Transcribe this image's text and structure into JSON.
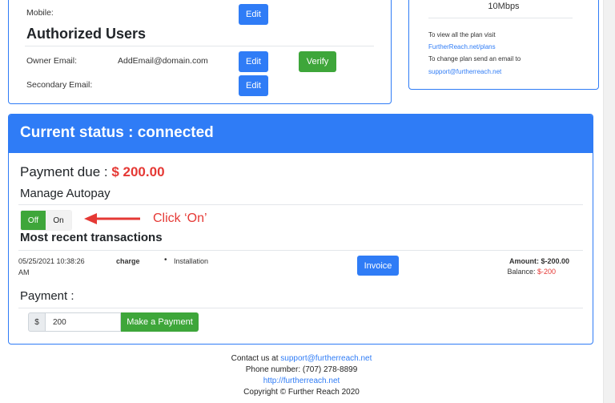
{
  "account": {
    "mobile_label": "Mobile:",
    "mobile_edit": "Edit",
    "authorized_users_title": "Authorized Users",
    "owner_email_label": "Owner Email:",
    "owner_email_value": "AddEmail@domain.com",
    "owner_edit": "Edit",
    "owner_verify": "Verify",
    "secondary_email_label": "Secondary Email:",
    "secondary_edit": "Edit"
  },
  "plan": {
    "speed": "10Mbps",
    "view_text": "To view all the plan visit",
    "plans_link": "FurtherReach.net/plans",
    "change_text": "To change plan send an email to",
    "support_link": "support@furtherreach.net"
  },
  "status": {
    "header": "Current status : connected",
    "payment_due_label": "Payment due : ",
    "payment_due_amount": "$ 200.00",
    "manage_autopay": "Manage Autopay",
    "toggle_off": "Off",
    "toggle_on": "On",
    "annotation": "Click ‘On’",
    "recent_transactions": "Most recent transactions"
  },
  "transactions": [
    {
      "date_line1": "05/25/2021 10:38:26",
      "date_line2": "AM",
      "type": "charge",
      "item": "Installation",
      "invoice_label": "Invoice",
      "amount_label": "Amount: $-200.00",
      "balance_label": "Balance: ",
      "balance_value": "$-200"
    }
  ],
  "payment": {
    "title": "Payment :",
    "currency_prefix": "$",
    "amount_value": "200",
    "submit_label": "Make a Payment"
  },
  "footer": {
    "contact_prefix": "Contact us at ",
    "contact_email": "support@furtherreach.net",
    "phone": "Phone number: (707) 278-8899",
    "website": "http://furtherreach.net",
    "copyright": "Copyright © Further Reach 2020"
  },
  "colors": {
    "primary": "#2f7cf6",
    "success": "#3ea63a",
    "danger": "#e53935",
    "link": "#2f7cf6"
  }
}
